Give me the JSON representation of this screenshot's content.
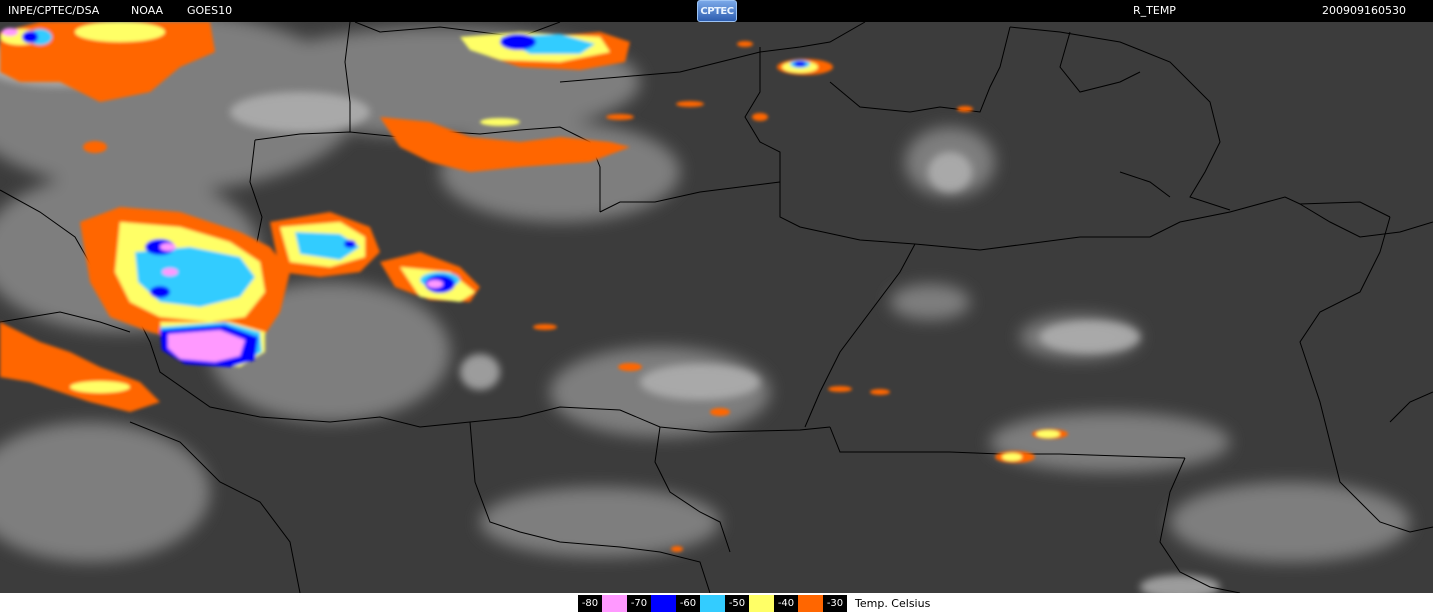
{
  "header": {
    "source": "INPE/CPTEC/DSA",
    "agency": "NOAA",
    "satellite": "GOES10",
    "logo_text": "CPTEC",
    "product": "R_TEMP",
    "timestamp": "200909160530"
  },
  "legend": {
    "unit": "Temp. Celsius",
    "items": [
      {
        "value": "-80",
        "color": "#ff99ff"
      },
      {
        "value": "-70",
        "color": "#0000ff"
      },
      {
        "value": "-60",
        "color": "#33ccff"
      },
      {
        "value": "-50",
        "color": "#ffff66"
      },
      {
        "value": "-40",
        "color": "#ff6600"
      },
      {
        "value": "-30",
        "color": "#000000"
      }
    ]
  },
  "colors": {
    "background": "#3c3c3c",
    "cloud": "#bdbdbd",
    "border": "#000000"
  }
}
